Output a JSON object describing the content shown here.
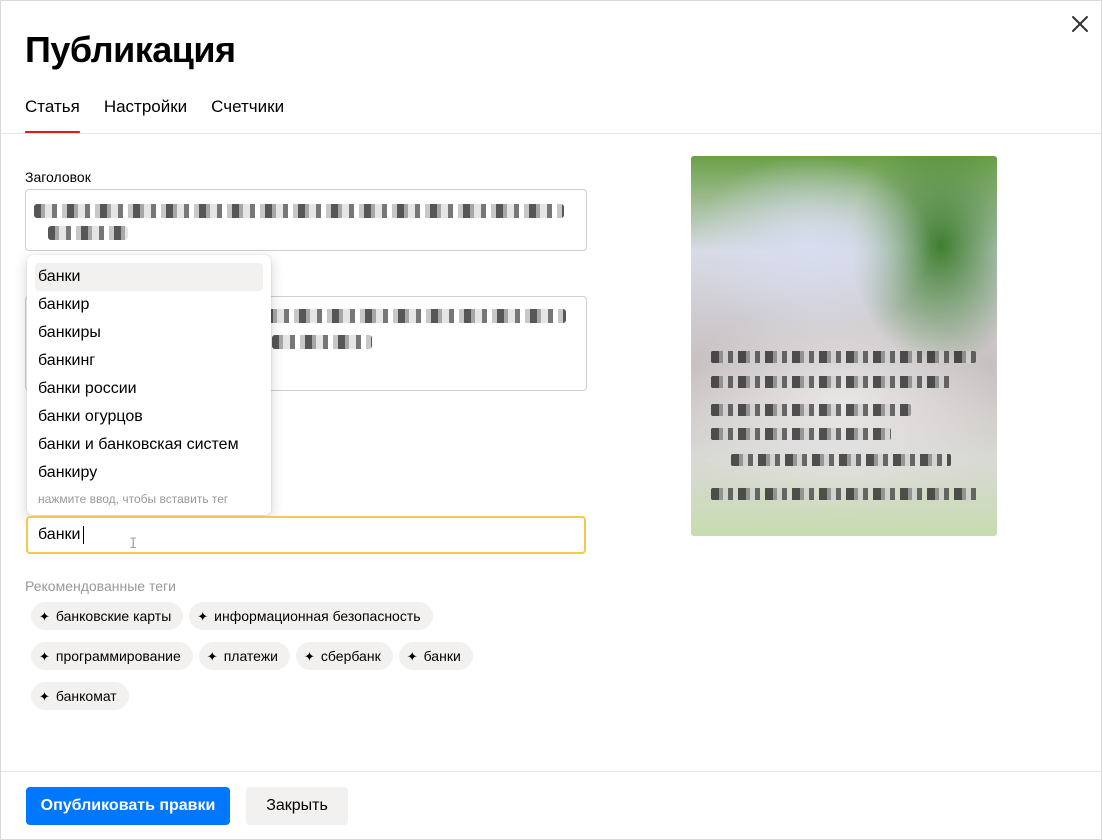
{
  "dialog": {
    "title": "Публикация",
    "close_icon": "close-icon"
  },
  "tabs": [
    {
      "label": "Статья",
      "active": true
    },
    {
      "label": "Настройки",
      "active": false
    },
    {
      "label": "Счетчики",
      "active": false
    }
  ],
  "form": {
    "title_label": "Заголовок",
    "tag_input_value": "банки"
  },
  "suggestions": {
    "items": [
      "банки",
      "банкир",
      "банкиры",
      "банкинг",
      "банки россии",
      "банки огурцов",
      "банки и банковская систем",
      "банкиру"
    ],
    "highlighted_index": 0,
    "hint": "нажмите ввод, чтобы вставить тег"
  },
  "recommended": {
    "label": "Рекомендованные теги",
    "chip_icon": "sparkle-icon",
    "tags": [
      "банковские карты",
      "информационная безопасность",
      "программирование",
      "платежи",
      "сбербанк",
      "банки",
      "банкомат"
    ]
  },
  "footer": {
    "publish_label": "Опубликовать правки",
    "close_label": "Закрыть"
  },
  "colors": {
    "accent_tab": "#e21a1a",
    "primary_button": "#0077ff",
    "input_focus": "#f2c94c",
    "chip_bg": "#f2f1ef"
  }
}
